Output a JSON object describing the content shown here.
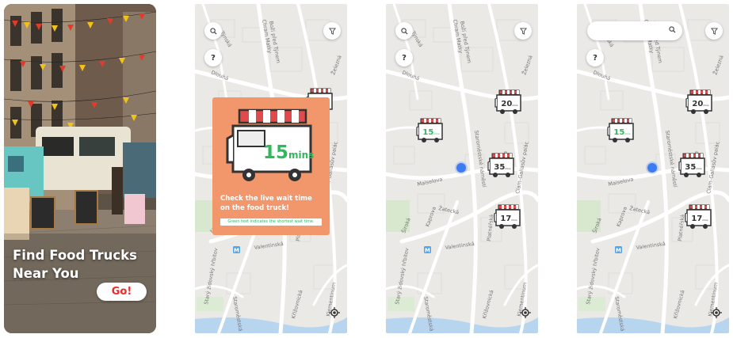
{
  "splash": {
    "title_line1": "Find Food Trucks",
    "title_line2": "Near You",
    "go_label": "Go!"
  },
  "map_controls": {
    "help_label": "?"
  },
  "onboarding": {
    "wait_value": "15",
    "wait_unit": "mins",
    "heading": "Check the live wait time on the food truck!",
    "note": "Green text indicates the shortest wait time."
  },
  "street_labels": [
    "Týnská",
    "Chram Matky Boží před Týnem",
    "Dlouhá",
    "Staroměstské náměstí",
    "Maiselova",
    "Žatecká",
    "Kaprova",
    "Valentinská",
    "Široká",
    "Platnéřská",
    "Staroměstská",
    "Clam-Gallasův palác",
    "Husova",
    "Karlova",
    "Klementinum",
    "Starý židovský hřbitov",
    "Křižovnická",
    "Železná",
    "Kozí",
    "Pařížská",
    "Celetná",
    "Melantrichova",
    "Jilská"
  ],
  "trucks": [
    {
      "wait": "20",
      "unit": "mins",
      "shortest": false
    },
    {
      "wait": "15",
      "unit": "mins",
      "shortest": true
    },
    {
      "wait": "35",
      "unit": "mins",
      "shortest": false
    },
    {
      "wait": "17",
      "unit": "mins",
      "shortest": false
    }
  ],
  "colors": {
    "map_bg": "#ebe9e6",
    "road": "#ffffff",
    "go_text": "#ec2a2a",
    "card_bg": "#f2966b",
    "shortest_green": "#2fb85c",
    "user_dot": "#3d7bf2",
    "metro": "#53a6e8"
  },
  "icons": [
    "search-icon",
    "filter-icon",
    "help-icon",
    "locate-icon",
    "food-truck-icon",
    "metro-icon"
  ]
}
